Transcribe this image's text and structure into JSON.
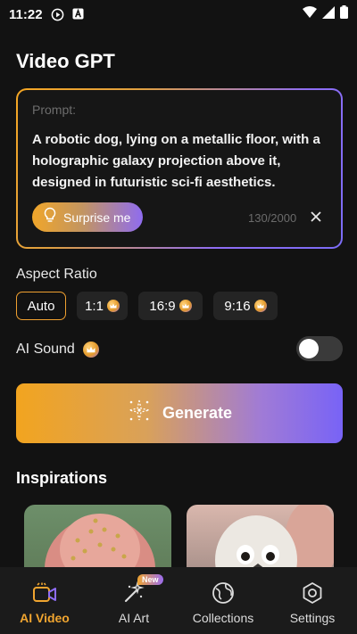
{
  "status_bar": {
    "time": "11:22"
  },
  "page": {
    "title": "Video GPT"
  },
  "prompt": {
    "label": "Prompt:",
    "text": "A robotic dog, lying on a metallic floor, with a holographic galaxy projection above it, designed in futuristic sci-fi aesthetics.",
    "surprise_label": "Surprise me",
    "char_count": "130/2000"
  },
  "aspect_ratio": {
    "label": "Aspect Ratio",
    "options": [
      {
        "label": "Auto",
        "selected": true,
        "premium": false
      },
      {
        "label": "1:1",
        "selected": false,
        "premium": true
      },
      {
        "label": "16:9",
        "selected": false,
        "premium": true
      },
      {
        "label": "9:16",
        "selected": false,
        "premium": true
      }
    ]
  },
  "ai_sound": {
    "label": "AI Sound",
    "enabled": false
  },
  "generate": {
    "label": "Generate"
  },
  "inspirations": {
    "title": "Inspirations"
  },
  "nav": {
    "items": [
      {
        "label": "AI Video",
        "icon": "video-icon",
        "active": true
      },
      {
        "label": "AI Art",
        "icon": "magic-wand-icon",
        "active": false,
        "badge": "New"
      },
      {
        "label": "Collections",
        "icon": "globe-icon",
        "active": false
      },
      {
        "label": "Settings",
        "icon": "settings-icon",
        "active": false
      }
    ]
  },
  "colors": {
    "accent_orange": "#f0a530",
    "accent_purple": "#7b6cf6",
    "background": "#121212"
  }
}
